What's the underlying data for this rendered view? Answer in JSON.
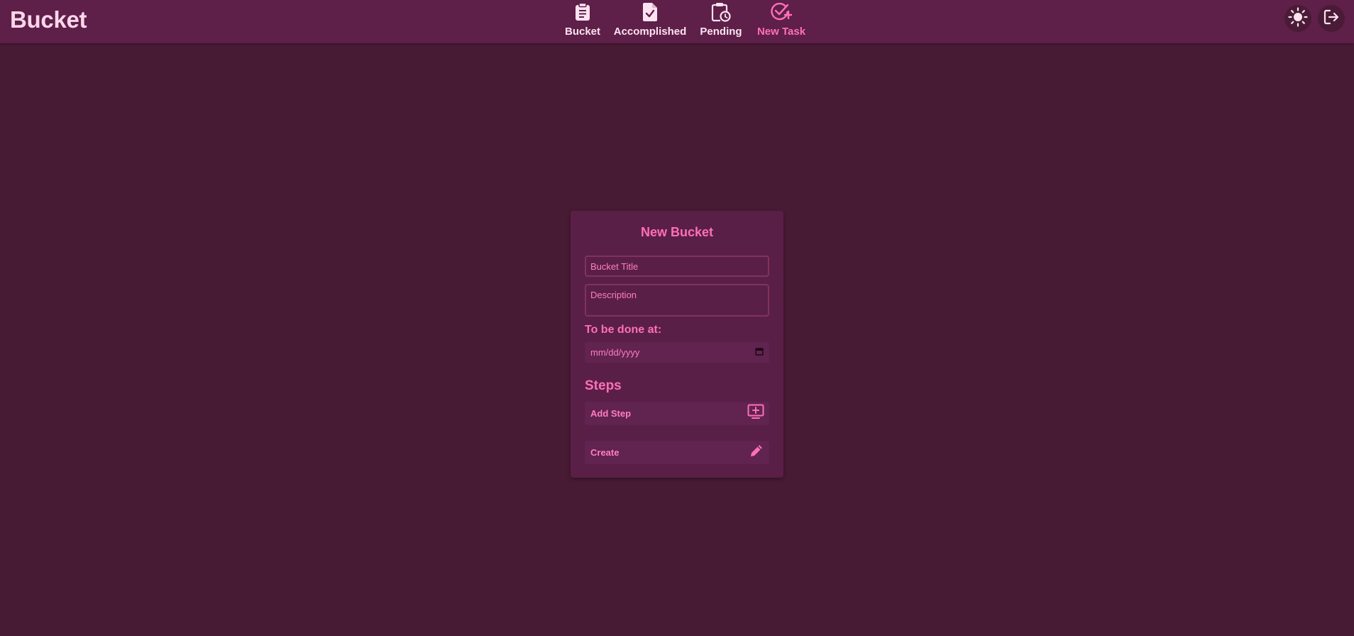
{
  "app": {
    "brand": "Bucket"
  },
  "nav": {
    "items": [
      {
        "label": "Bucket",
        "icon": "clipboard-list-icon",
        "active": false
      },
      {
        "label": "Accomplished",
        "icon": "file-check-icon",
        "active": false
      },
      {
        "label": "Pending",
        "icon": "clipboard-clock-icon",
        "active": false
      },
      {
        "label": "New Task",
        "icon": "circle-check-plus-icon",
        "active": true
      }
    ]
  },
  "header_actions": {
    "theme_icon": "sun-icon",
    "logout_icon": "logout-icon"
  },
  "form": {
    "title": "New Bucket",
    "title_placeholder": "Bucket Title",
    "title_value": "",
    "description_placeholder": "Description",
    "description_value": "",
    "date_label": "To be done at:",
    "date_placeholder": "mm/dd/yyyy",
    "steps_heading": "Steps",
    "add_step_label": "Add Step",
    "create_label": "Create"
  },
  "colors": {
    "background": "#481b35",
    "topbar": "#5e1f49",
    "accent": "#ff6fb8",
    "text_light": "#fbe3f0"
  }
}
